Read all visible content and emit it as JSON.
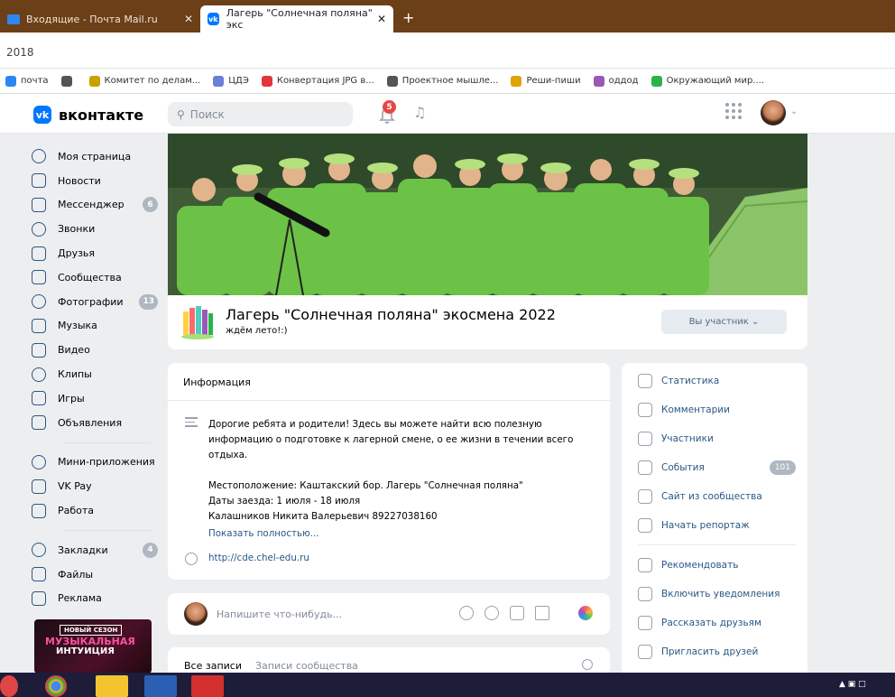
{
  "browser": {
    "tabs": [
      {
        "label": "Входящие - Почта Mail.ru",
        "close": "✕"
      },
      {
        "label": "Лагерь \"Солнечная поляна\" экс",
        "close": "✕"
      }
    ],
    "new_tab": "+",
    "address_text": "2018",
    "bookmarks": [
      {
        "label": "почта",
        "color": "#2e87f0"
      },
      {
        "label": "",
        "color": "#555555"
      },
      {
        "label": "Комитет по делам...",
        "color": "#c9a200"
      },
      {
        "label": "ЦДЭ",
        "color": "#6a7fd6"
      },
      {
        "label": "Конвертация JPG в...",
        "color": "#e0363b"
      },
      {
        "label": "Проектное мышле...",
        "color": "#555555"
      },
      {
        "label": "Реши-пиши",
        "color": "#e0a200"
      },
      {
        "label": "оддод",
        "color": "#9b59b6"
      },
      {
        "label": "Окружающий мир....",
        "color": "#2ab34a"
      }
    ]
  },
  "vk": {
    "logo_text": "вконтакте",
    "search_placeholder": "Поиск",
    "notifications_count": "5"
  },
  "sidebar": {
    "items": [
      {
        "label": "Моя страница",
        "badge": ""
      },
      {
        "label": "Новости",
        "badge": ""
      },
      {
        "label": "Мессенджер",
        "badge": "6"
      },
      {
        "label": "Звонки",
        "badge": ""
      },
      {
        "label": "Друзья",
        "badge": ""
      },
      {
        "label": "Сообщества",
        "badge": ""
      },
      {
        "label": "Фотографии",
        "badge": "13"
      },
      {
        "label": "Музыка",
        "badge": ""
      },
      {
        "label": "Видео",
        "badge": ""
      },
      {
        "label": "Клипы",
        "badge": ""
      },
      {
        "label": "Игры",
        "badge": ""
      },
      {
        "label": "Объявления",
        "badge": ""
      }
    ],
    "items2": [
      {
        "label": "Мини-приложения",
        "badge": ""
      },
      {
        "label": "VK Pay",
        "badge": ""
      },
      {
        "label": "Работа",
        "badge": ""
      }
    ],
    "items3": [
      {
        "label": "Закладки",
        "badge": "4"
      },
      {
        "label": "Файлы",
        "badge": ""
      },
      {
        "label": "Реклама",
        "badge": ""
      }
    ],
    "promo": {
      "tag": "НОВЫЙ СЕЗОН",
      "line1": "МУЗЫКАЛЬНАЯ",
      "line2": "ИНТУИЦИЯ"
    }
  },
  "group": {
    "name": "Лагерь \"Солнечная поляна\" экосмена 2022",
    "status": "ждём лето!:)",
    "member_button": "Вы участник"
  },
  "info": {
    "title": "Информация",
    "description": "Дорогие ребята и родители! Здесь вы можете найти всю полезную информацию о подготовке к лагерной смене, о ее жизни в течении всего отдыха.",
    "location": "Местоположение: Каштакский бор. Лагерь \"Солнечная поляна\"",
    "dates": "Даты заезда: 1 июля - 18 июля",
    "contact": "Калашников Никита Валерьевич 89227038160",
    "show_more": "Показать полностью...",
    "site": "http://cde.chel-edu.ru"
  },
  "post": {
    "placeholder": "Напишите что-нибудь..."
  },
  "wall": {
    "tab_all": "Все записи",
    "tab_community": "Записи сообщества"
  },
  "right_actions": {
    "group1": [
      {
        "label": "Статистика",
        "count": ""
      },
      {
        "label": "Комментарии",
        "count": ""
      },
      {
        "label": "Участники",
        "count": ""
      },
      {
        "label": "События",
        "count": "101"
      },
      {
        "label": "Сайт из сообщества",
        "count": ""
      },
      {
        "label": "Начать репортаж",
        "count": ""
      }
    ],
    "group2": [
      {
        "label": "Рекомендовать",
        "count": ""
      },
      {
        "label": "Включить уведомления",
        "count": ""
      },
      {
        "label": "Рассказать друзьям",
        "count": ""
      },
      {
        "label": "Пригласить друзей",
        "count": ""
      }
    ]
  }
}
